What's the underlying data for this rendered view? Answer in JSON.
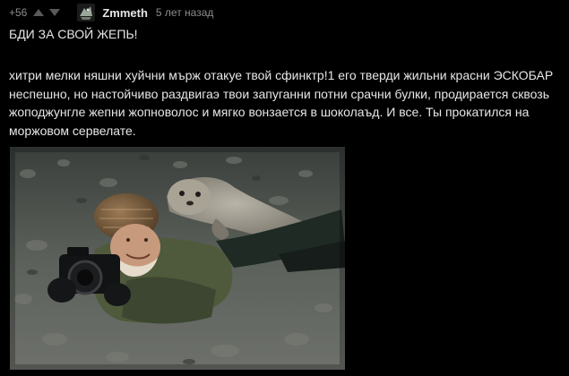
{
  "comment": {
    "rating": "+56",
    "upvote_icon": "triangle-up-icon",
    "downvote_icon": "triangle-down-icon",
    "author": "Zmmeth",
    "timestamp": "5 лет назад",
    "title": "БДИ ЗА СВОЙ ЖЕПЬ!",
    "body": "хитри мелки няшни хуйчни мърж отакуе твой сфинктр!1 его тверди жильни красни ЭСКОБАР неспешно, но настойчиво раздвигаэ твои запуганни потни срачни булки, продирается сквозь жоподжунгле жепни жопноволос и мягко вонзается в шоколаъд. И все. Ты прокатился на моржовом сервелате.",
    "image_description_icon": "photo-image"
  },
  "colors": {
    "background": "#000000",
    "text": "#e6e6e6",
    "muted": "#8c8c8c",
    "vote_arrow": "#5a5a5a"
  }
}
